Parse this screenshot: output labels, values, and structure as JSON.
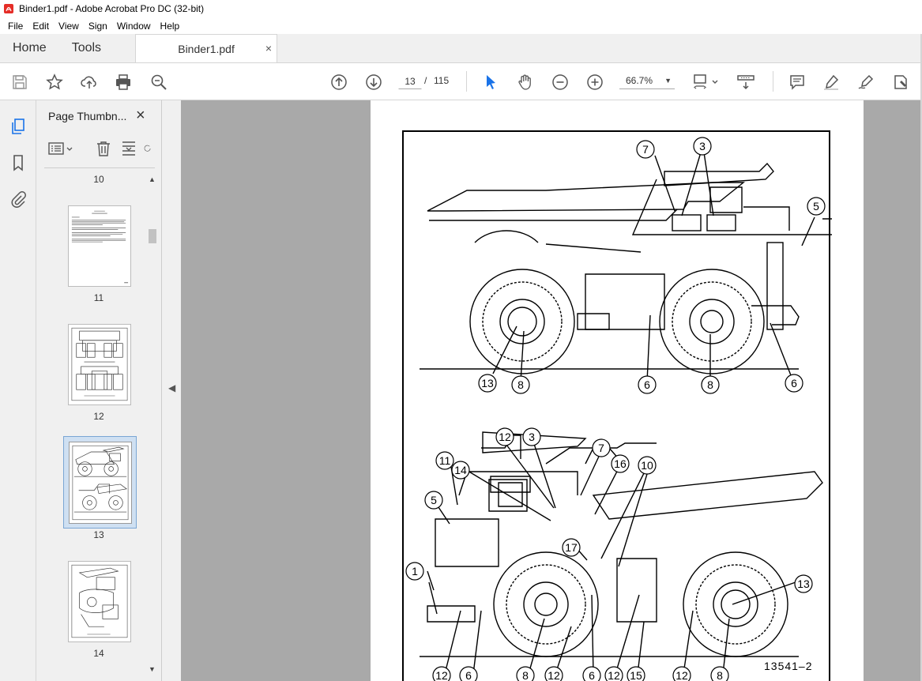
{
  "window": {
    "title": "Binder1.pdf - Adobe Acrobat Pro DC (32-bit)"
  },
  "menu": [
    "File",
    "Edit",
    "View",
    "Sign",
    "Window",
    "Help"
  ],
  "tabs": {
    "home": "Home",
    "tools": "Tools",
    "document": "Binder1.pdf",
    "document_close": "×"
  },
  "toolbar": {
    "current_page": "13",
    "page_separator": "/",
    "total_pages": "115",
    "zoom": "66.7%"
  },
  "thumbnails_panel": {
    "title": "Page Thumbn...",
    "close": "×",
    "pages": [
      {
        "label": "10"
      },
      {
        "label": "11"
      },
      {
        "label": "12"
      },
      {
        "label": "13",
        "selected": true
      },
      {
        "label": "14"
      }
    ]
  },
  "document": {
    "figure_code": "13541–2",
    "upper_callouts": [
      "7",
      "3",
      "5",
      "13",
      "8",
      "6",
      "8",
      "6"
    ],
    "lower_callouts": [
      "12",
      "3",
      "7",
      "11",
      "14",
      "16",
      "10",
      "5",
      "17",
      "1",
      "13",
      "12",
      "6",
      "8",
      "12",
      "6",
      "12",
      "15",
      "12",
      "8"
    ]
  },
  "colors": {
    "accent": "#1a73e8",
    "selected_thumb": "#cfe0f2",
    "canvas": "#a9a9a9",
    "acrobat_red": "#e52d27"
  }
}
